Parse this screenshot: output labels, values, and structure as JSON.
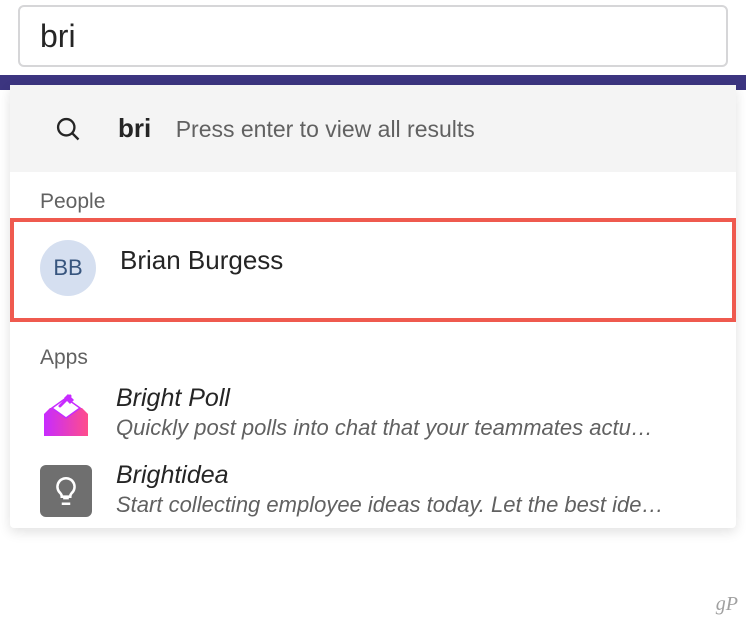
{
  "search": {
    "value": "bri"
  },
  "viewAll": {
    "term": "bri",
    "hint": "Press enter to view all results"
  },
  "sections": {
    "people_label": "People",
    "apps_label": "Apps"
  },
  "people": [
    {
      "initials": "BB",
      "name": "Brian Burgess"
    }
  ],
  "apps": [
    {
      "icon": "brightpoll-icon",
      "title": "Bright Poll",
      "desc": "Quickly post polls into chat that your teammates actu…"
    },
    {
      "icon": "brightidea-icon",
      "title": "Brightidea",
      "desc": "Start collecting employee ideas today. Let the best ide…"
    }
  ],
  "watermark": "gP"
}
